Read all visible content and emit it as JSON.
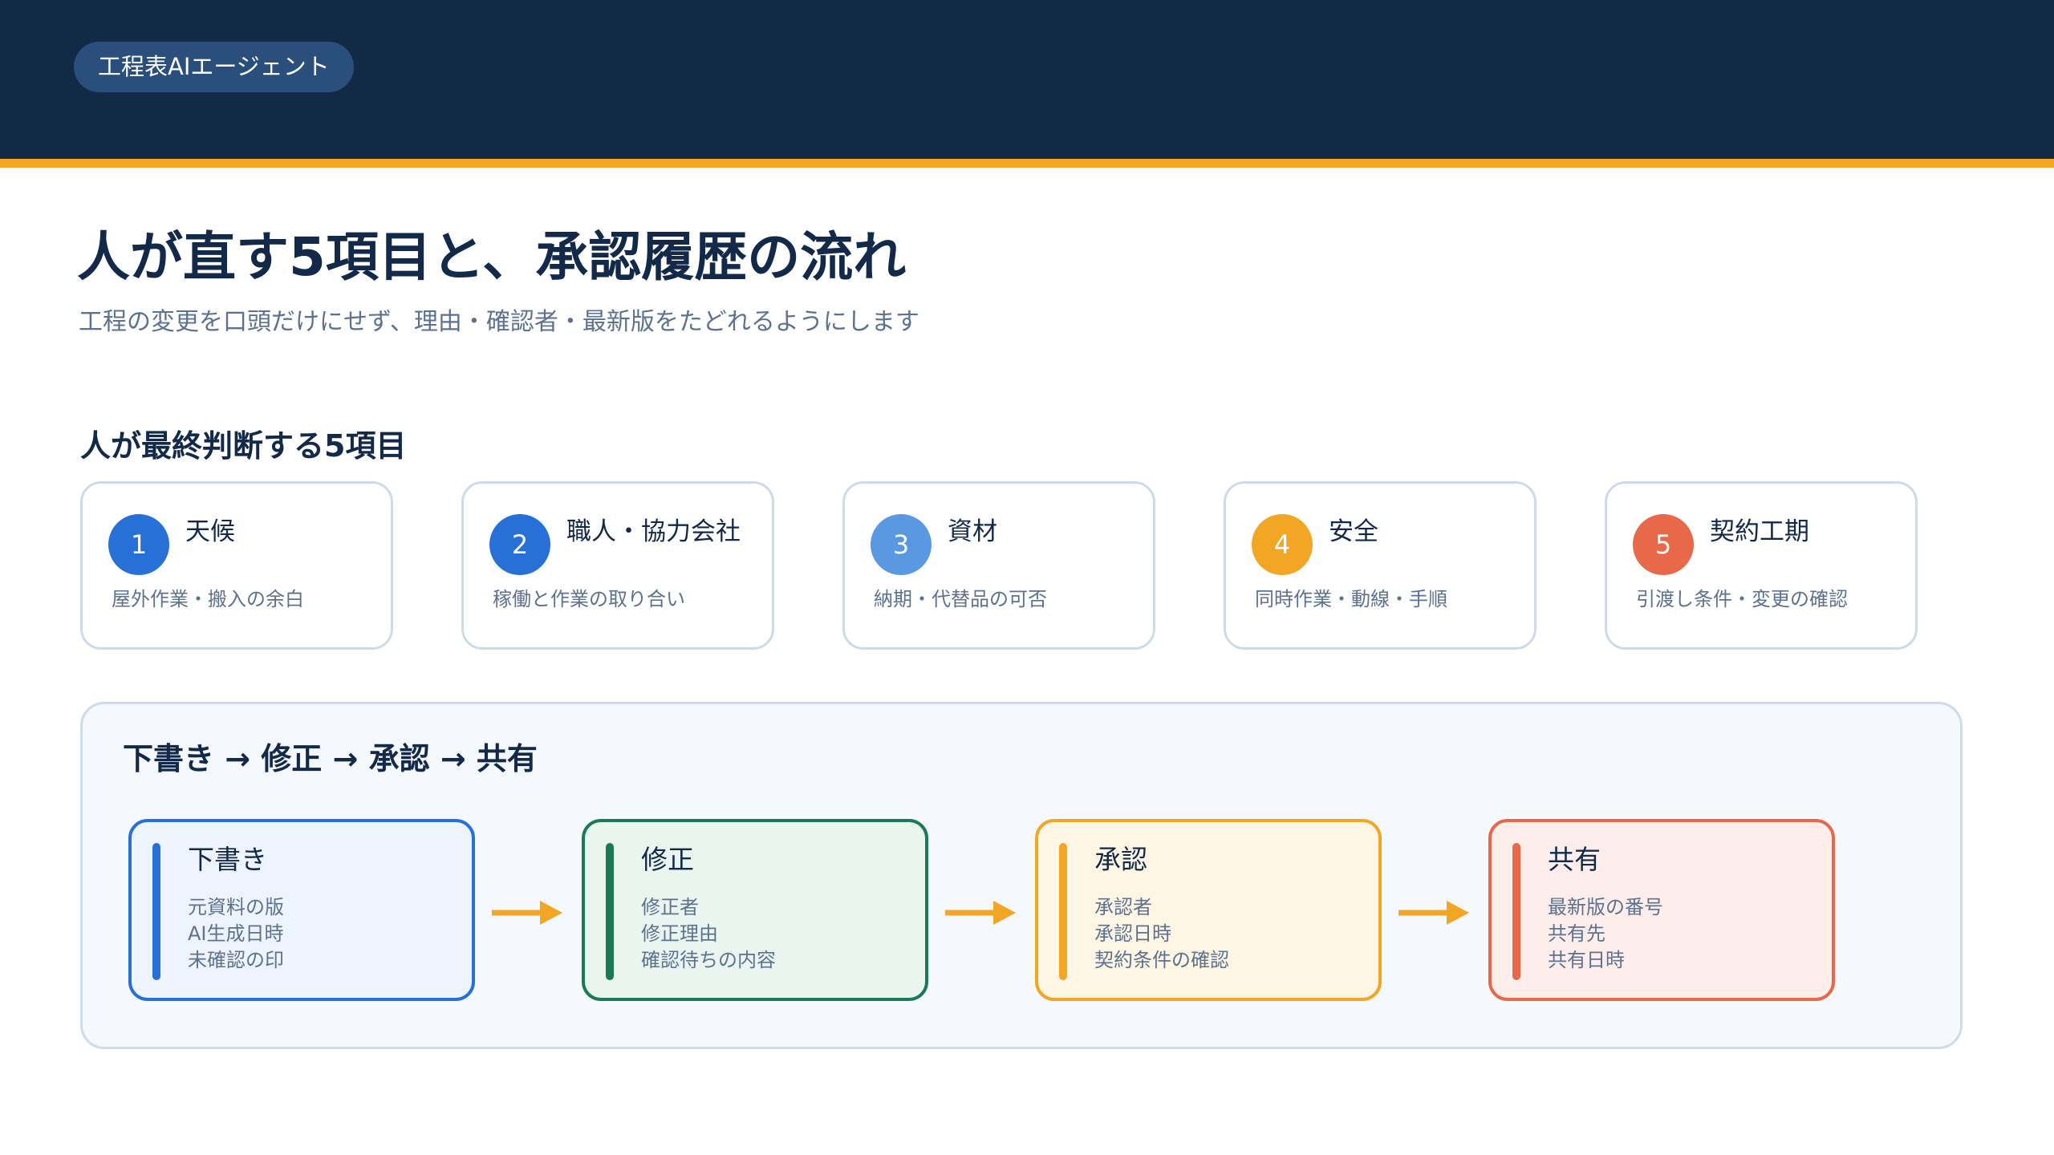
{
  "header": {
    "app_name": "工程表AIエージェント"
  },
  "page": {
    "title": "人が直す5項目と、承認履歴の流れ",
    "subtitle": "工程の変更を口頭だけにせず、理由・確認者・最新版をたどれるようにします"
  },
  "items_section": {
    "heading": "人が最終判断する5項目",
    "items": [
      {
        "number": "1",
        "label": "天候",
        "description": "屋外作業・搬入の余白",
        "color": "#2670d8"
      },
      {
        "number": "2",
        "label": "職人・協力会社",
        "description": "稼働と作業の取り合い",
        "color": "#2670d8"
      },
      {
        "number": "3",
        "label": "資材",
        "description": "納期・代替品の可否",
        "color": "#5a98e2"
      },
      {
        "number": "4",
        "label": "安全",
        "description": "同時作業・動線・手順",
        "color": "#f2a623"
      },
      {
        "number": "5",
        "label": "契約工期",
        "description": "引渡し条件・変更の確認",
        "color": "#e8694a"
      }
    ]
  },
  "flow": {
    "heading": "下書き → 修正 → 承認 → 共有",
    "steps": [
      {
        "title": "下書き",
        "lines": [
          "元資料の版",
          "AI生成日時",
          "未確認の印"
        ],
        "accent": "#2670d8",
        "background": "#edf4fd"
      },
      {
        "title": "修正",
        "lines": [
          "修正者",
          "修正理由",
          "確認待ちの内容"
        ],
        "accent": "#197a55",
        "background": "#ebf5f0"
      },
      {
        "title": "承認",
        "lines": [
          "承認者",
          "承認日時",
          "契約条件の確認"
        ],
        "accent": "#f2a623",
        "background": "#fef6e4"
      },
      {
        "title": "共有",
        "lines": [
          "最新版の番号",
          "共有先",
          "共有日時"
        ],
        "accent": "#e8694a",
        "background": "#fdeeeb"
      }
    ],
    "arrow_color": "#f2a623"
  }
}
